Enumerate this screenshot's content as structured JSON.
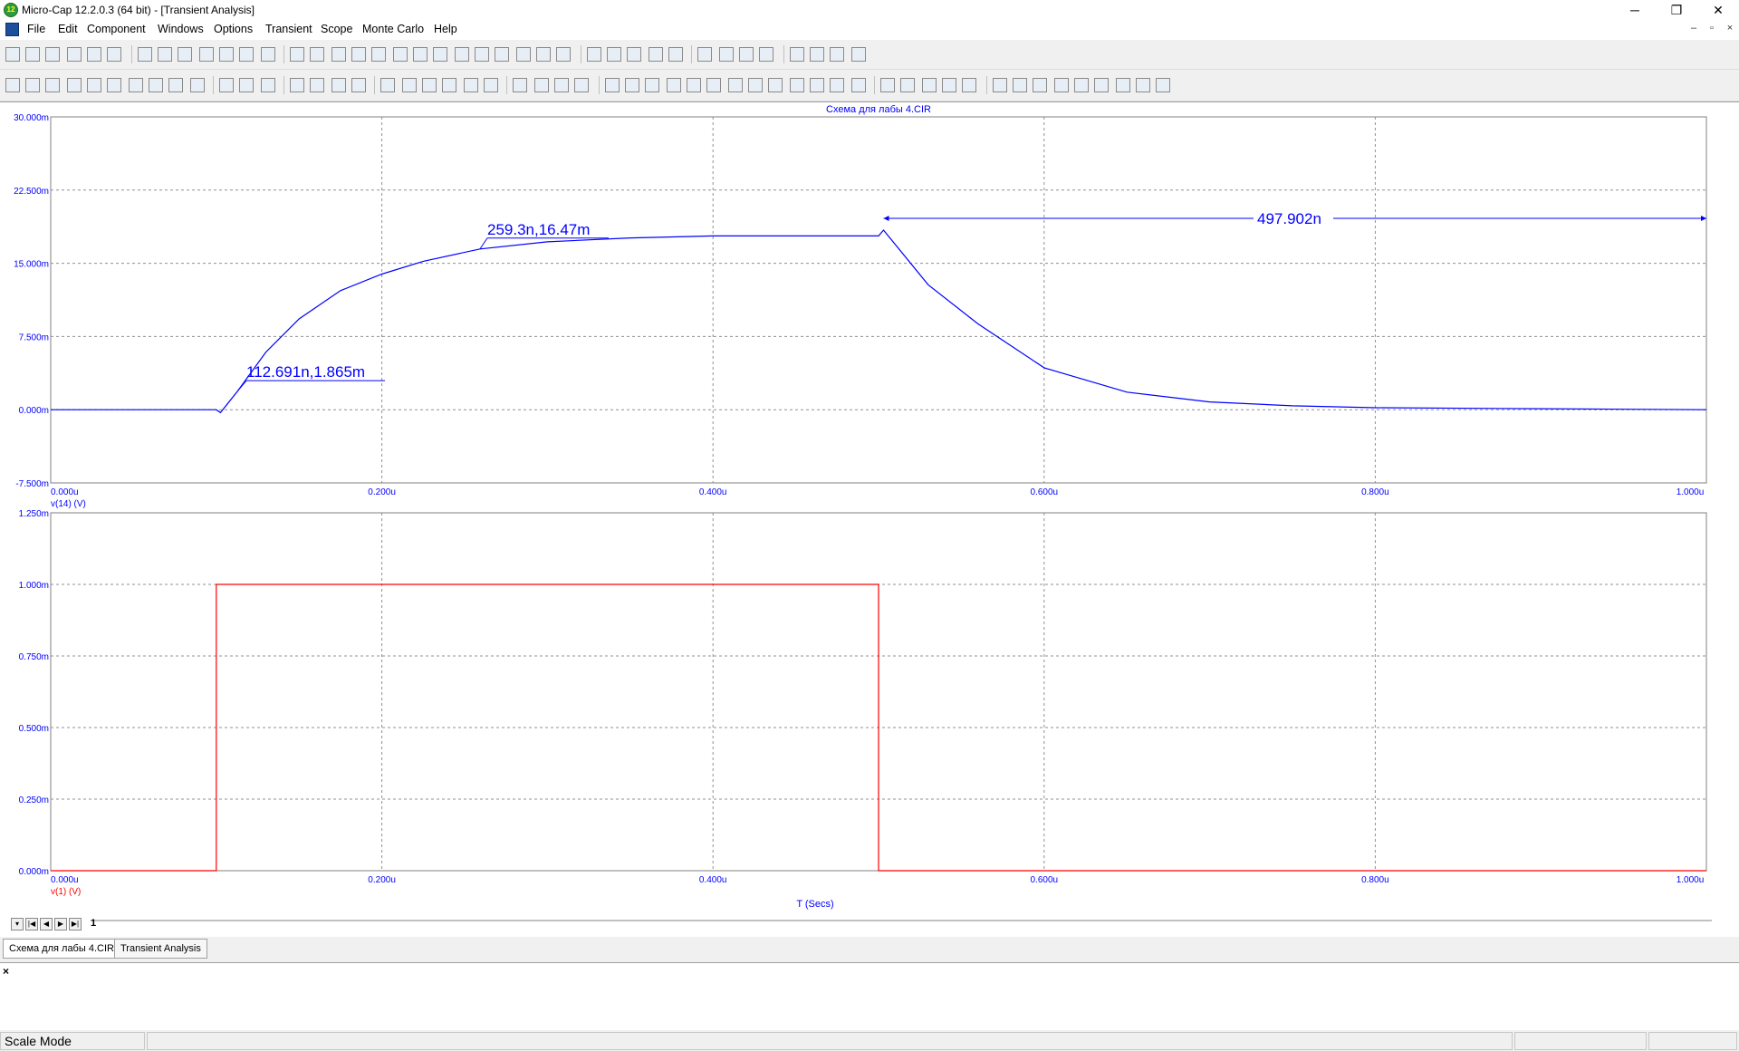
{
  "window": {
    "title": "Micro-Cap 12.2.0.3 (64 bit) - [Transient Analysis]",
    "app_icon_text": "12",
    "minimize": "─",
    "restore": "❐",
    "close": "✕",
    "mdi_minimize": "–",
    "mdi_restore": "▫",
    "mdi_close": "×"
  },
  "menu": [
    "File",
    "Edit",
    "Component",
    "Windows",
    "Options",
    "Transient",
    "Scope",
    "Monte Carlo",
    "Help"
  ],
  "toolbar1_icons": [
    "new-icon",
    "open-icon",
    "save-icon",
    "save-all-icon",
    "print-preview-icon",
    "print-icon",
    "undo-icon",
    "redo-icon",
    "cut-icon",
    "copy-icon",
    "paste-icon",
    "delete-icon",
    "select-all-icon",
    "ground-icon",
    "resistor-icon",
    "inductor-icon",
    "capacitor-icon",
    "diode-icon",
    "battery-icon",
    "transistor-icon",
    "mosfet-icon",
    "opamp-icon",
    "source-icon",
    "wire-icon",
    "junction-icon",
    "probe-icon",
    "cascade-icon",
    "tile-h-icon",
    "tile-v-icon",
    "window-icon",
    "window-2-icon",
    "calc-icon",
    "page-icon",
    "properties-icon",
    "parts-icon",
    "libraries-icon",
    "settings-icon",
    "analysis-icon",
    "plot-icon",
    "run-icon"
  ],
  "toolbar2_icons": [
    "select-icon",
    "pan-icon",
    "scale-icon",
    "grid-icon",
    "zoom-region-icon",
    "text-icon",
    "graph-icon",
    "point-icon",
    "font-icon",
    "tag-icon",
    "run-icon",
    "stop-icon",
    "pause-icon",
    "scale-auto-icon",
    "scale-x-icon",
    "box-icon",
    "grid-fine-icon",
    "table-icon",
    "table-2-icon",
    "table-3-icon",
    "table-4-icon",
    "rows-icon",
    "cols-icon",
    "zoom-in-icon",
    "zoom-out-icon",
    "zoom-fit-icon",
    "zoom-reset-icon",
    "cursor-icon",
    "peak-icon",
    "valley-icon",
    "high-icon",
    "low-icon",
    "inflect-icon",
    "slope-icon",
    "global-high-icon",
    "global-low-icon",
    "bottom-icon",
    "top-icon",
    "tag-v-icon",
    "tag-h-icon",
    "chart-icon",
    "data-icon",
    "next-icon",
    "prev-icon",
    "zoom-in-2-icon",
    "zoom-out-2-icon",
    "redraw-icon",
    "tokens-icon",
    "font-a-icon",
    "color-icon",
    "stack-icon",
    "overlay-icon",
    "split-h-icon",
    "split-v-icon"
  ],
  "plot": {
    "title": "Схема для лабы 4.CIR",
    "x_axis_label": "T (Secs)",
    "x_ticks": [
      "0.000u",
      "0.200u",
      "0.400u",
      "0.600u",
      "0.800u",
      "1.000u"
    ],
    "top_y_ticks": [
      "30.000m",
      "22.500m",
      "15.000m",
      "7.500m",
      "0.000m",
      "-7.500m"
    ],
    "bottom_y_ticks": [
      "1.250m",
      "1.000m",
      "0.750m",
      "0.500m",
      "0.250m",
      "0.000m"
    ],
    "top_curve_label": "v(14) (V)",
    "bottom_curve_label": "v(1) (V)",
    "top_color": "#0000ff",
    "bottom_color": "#ff0000",
    "annotation_1": "112.691n,1.865m",
    "annotation_2": "259.3n,16.47m",
    "annotation_3": "497.902n"
  },
  "chart_data": [
    {
      "type": "line",
      "title": "Схема для лабы 4.CIR",
      "xlabel": "T (Secs)",
      "ylabel": "v(14) (V)",
      "xlim": [
        0,
        1e-06
      ],
      "ylim": [
        -0.0075,
        0.03
      ],
      "grid": true,
      "series": [
        {
          "name": "v(14) (V)",
          "x": [
            0,
            1e-07,
            1.025e-07,
            1.127e-07,
            1.3e-07,
            1.5e-07,
            1.75e-07,
            2e-07,
            2.25e-07,
            2.593e-07,
            3e-07,
            3.5e-07,
            4e-07,
            4.5e-07,
            5e-07,
            5.03e-07,
            5.3e-07,
            5.6e-07,
            6e-07,
            6.5e-07,
            7e-07,
            7.5e-07,
            8e-07,
            9e-07,
            1e-06
          ],
          "y": [
            0,
            0,
            -0.0003,
            0.001865,
            0.0059,
            0.0093,
            0.0122,
            0.0139,
            0.0152,
            0.01647,
            0.0172,
            0.0176,
            0.0178,
            0.0178,
            0.0178,
            0.0184,
            0.0128,
            0.0088,
            0.0043,
            0.0018,
            0.0008,
            0.0004,
            0.0002,
            0.0001,
            0.0
          ]
        }
      ],
      "annotations": [
        "112.691n,1.865m",
        "259.3n,16.47m",
        "497.902n"
      ]
    },
    {
      "type": "line",
      "title": "",
      "xlabel": "T (Secs)",
      "ylabel": "v(1) (V)",
      "xlim": [
        0,
        1e-06
      ],
      "ylim": [
        0,
        0.00125
      ],
      "grid": true,
      "series": [
        {
          "name": "v(1) (V)",
          "x": [
            0,
            1e-07,
            1e-07,
            5e-07,
            5e-07,
            1e-06
          ],
          "y": [
            0,
            0,
            0.001,
            0.001,
            0,
            0
          ]
        }
      ]
    }
  ],
  "page_tabs": {
    "nav": [
      "▾",
      "|◀",
      "◀",
      "▶",
      "▶|"
    ],
    "current": "1"
  },
  "doc_tabs": [
    "Схема для лабы 4.CIR",
    "Transient Analysis"
  ],
  "output_close": "×",
  "status": {
    "mode": "Scale Mode"
  }
}
